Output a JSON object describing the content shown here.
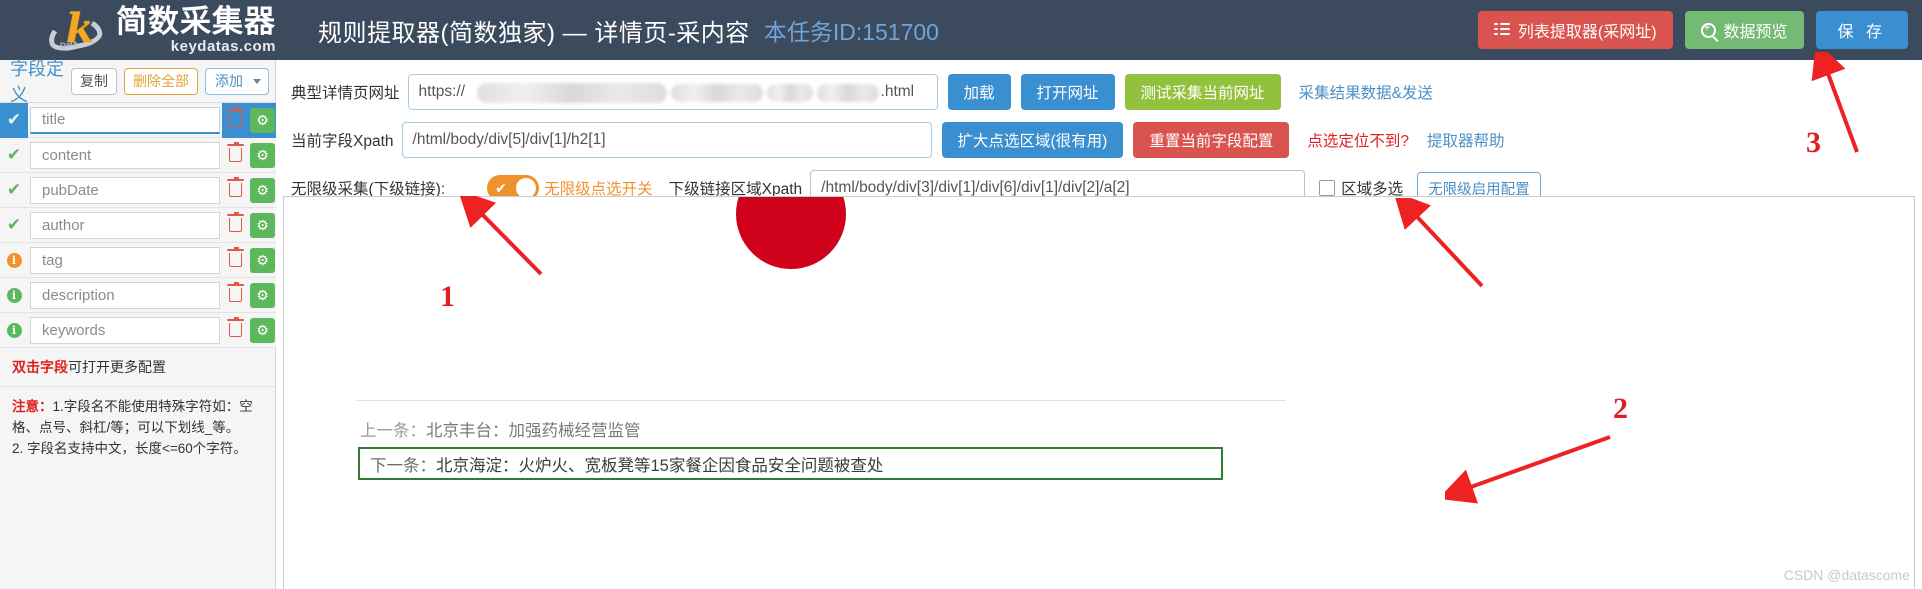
{
  "header": {
    "brand_cn": "简数采集器",
    "brand_en": "keydatas.com",
    "title": "规则提取器(简数独家) — 详情页-采内容",
    "task_id_label": "本任务ID:151700",
    "buttons": {
      "list_extractor": "列表提取器(采网址)",
      "data_preview": "数据预览",
      "save": "保 存"
    },
    "icons": {
      "list": "list-icon",
      "zoom": "zoom-in-icon"
    },
    "colors": {
      "bar": "#3c4a5e",
      "red": "#d9534f",
      "green": "#74b974",
      "blue": "#3a8fd0",
      "accent_text": "#6fa5d8"
    }
  },
  "sidebar": {
    "title": "字段定义",
    "buttons": {
      "copy": "复制",
      "delete_all": "删除全部",
      "add": "添加"
    },
    "fields": [
      {
        "name": "title",
        "status": "check",
        "selected": true
      },
      {
        "name": "content",
        "status": "check",
        "selected": false
      },
      {
        "name": "pubDate",
        "status": "check",
        "selected": false
      },
      {
        "name": "author",
        "status": "check",
        "selected": false
      },
      {
        "name": "tag",
        "status": "info-orange",
        "selected": false
      },
      {
        "name": "description",
        "status": "info-green",
        "selected": false
      },
      {
        "name": "keywords",
        "status": "info-green",
        "selected": false
      }
    ],
    "note_hint_bold": "双击字段",
    "note_hint_rest": "可打开更多配置",
    "note_warn_bold": "注意：",
    "note_warn_line1": "1.字段名不能使用特殊字符如：空",
    "note_warn_line2": "格、点号、斜杠/等；可以下划线_等。",
    "note_warn_line3": "2. 字段名支持中文，长度<=60个字符。"
  },
  "form": {
    "url_label": "典型详情页网址",
    "url_value_prefix": "https://",
    "url_value_suffix": ".html",
    "btn_load": "加载",
    "btn_open_url": "打开网址",
    "btn_test_collect": "测试采集当前网址",
    "link_result_data": "采集结果数据&发送",
    "xpath_label": "当前字段Xpath",
    "xpath_value": "/html/body/div[5]/div[1]/h2[1]",
    "btn_expand_click": "扩大点选区域(很有用)",
    "btn_reset_field": "重置当前字段配置",
    "link_cannot_select": "点选定位不到?",
    "link_extractor_help": "提取器帮助",
    "sub_label": "无限级采集(下级链接):",
    "toggle_label": "无限级点选开关",
    "sub_xpath_label": "下级链接区域Xpath",
    "sub_xpath_value": "/html/body/div[3]/div[1]/div[6]/div[1]/div[2]/a[2]",
    "checkbox_multi": "区域多选",
    "btn_enable_unlimited": "无限级启用配置"
  },
  "preview": {
    "prev_lead": "上一条：",
    "prev_text": "北京丰台：加强药械经营监管",
    "next_lead": "下一条：",
    "next_text": "北京海淀：火炉火、宽板凳等15家餐企因食品安全问题被查处"
  },
  "annotations": {
    "one": "1",
    "two": "2",
    "three": "3"
  },
  "watermark": "CSDN @datascome"
}
